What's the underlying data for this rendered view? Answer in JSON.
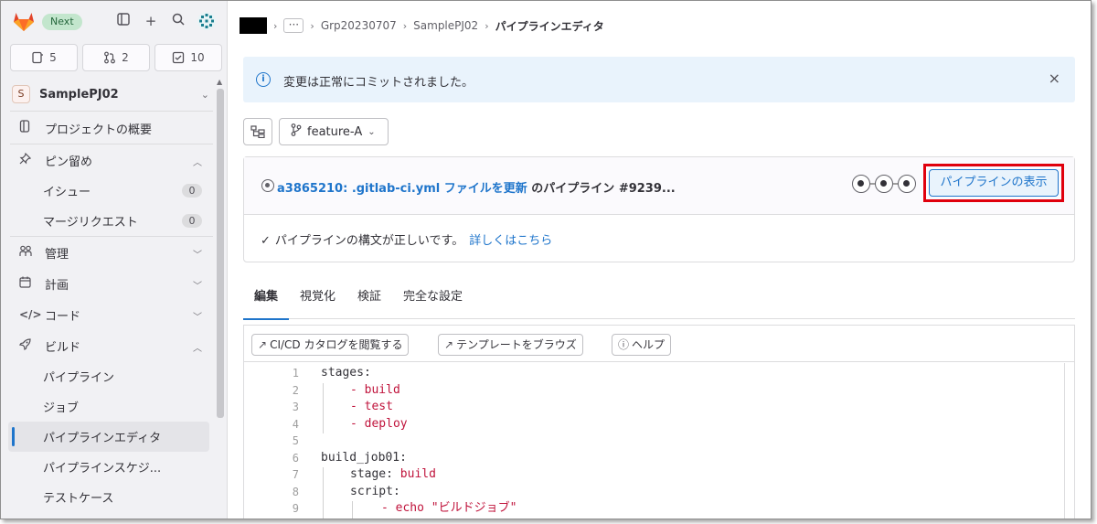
{
  "sidebar": {
    "next_badge": "Next",
    "counts": [
      {
        "icon": "issues-icon",
        "value": "5"
      },
      {
        "icon": "merge-request-icon",
        "value": "2"
      },
      {
        "icon": "todo-icon",
        "value": "10"
      }
    ],
    "project": {
      "avatar_letter": "S",
      "name": "SamplePJ02"
    },
    "nav": {
      "overview": "プロジェクトの概要",
      "pinned": "ピン留め",
      "issues": "イシュー",
      "issues_count": "0",
      "merge_requests": "マージリクエスト",
      "mr_count": "0",
      "manage": "管理",
      "plan": "計画",
      "code": "コード",
      "build": "ビルド",
      "pipelines": "パイプライン",
      "jobs": "ジョブ",
      "pipeline_editor": "パイプラインエディタ",
      "pipeline_schedules": "パイプラインスケジ...",
      "test_cases": "テストケース"
    }
  },
  "breadcrumb": {
    "more": "···",
    "group": "Grp20230707",
    "project": "SamplePJ02",
    "current": "パイプラインエディタ"
  },
  "alert": {
    "message": "変更は正常にコミットされました。",
    "close": "×"
  },
  "branch": {
    "name": "feature-A"
  },
  "pipeline": {
    "commit_link": "a3865210: .gitlab-ci.yml ファイルを更新",
    "middle": " のパイプライン ",
    "id": "#9239...",
    "view_button": "パイプラインの表示",
    "lint_message": "パイプラインの構文が正しいです。",
    "lint_link": "詳しくはこちら"
  },
  "tabs": [
    {
      "label": "編集",
      "active": true
    },
    {
      "label": "視覚化"
    },
    {
      "label": "検証"
    },
    {
      "label": "完全な設定"
    }
  ],
  "editor_toolbar": {
    "catalog": "CI/CD カタログを閲覧する",
    "templates": "テンプレートをブラウズ",
    "help": "ヘルプ"
  },
  "code_lines": [
    {
      "n": "1",
      "text": "stages:"
    },
    {
      "n": "2",
      "text": "- build"
    },
    {
      "n": "3",
      "text": "- test"
    },
    {
      "n": "4",
      "text": "- deploy"
    },
    {
      "n": "5",
      "text": ""
    },
    {
      "n": "6",
      "text": "build_job01:"
    },
    {
      "n": "7",
      "key": "stage: ",
      "val": "build"
    },
    {
      "n": "8",
      "text": "script:"
    },
    {
      "n": "9",
      "text": "- echo \"ビルドジョブ\""
    }
  ],
  "colors": {
    "accent": "#1f75cb",
    "highlight": "#e0000d",
    "code_value": "#c0143c"
  }
}
